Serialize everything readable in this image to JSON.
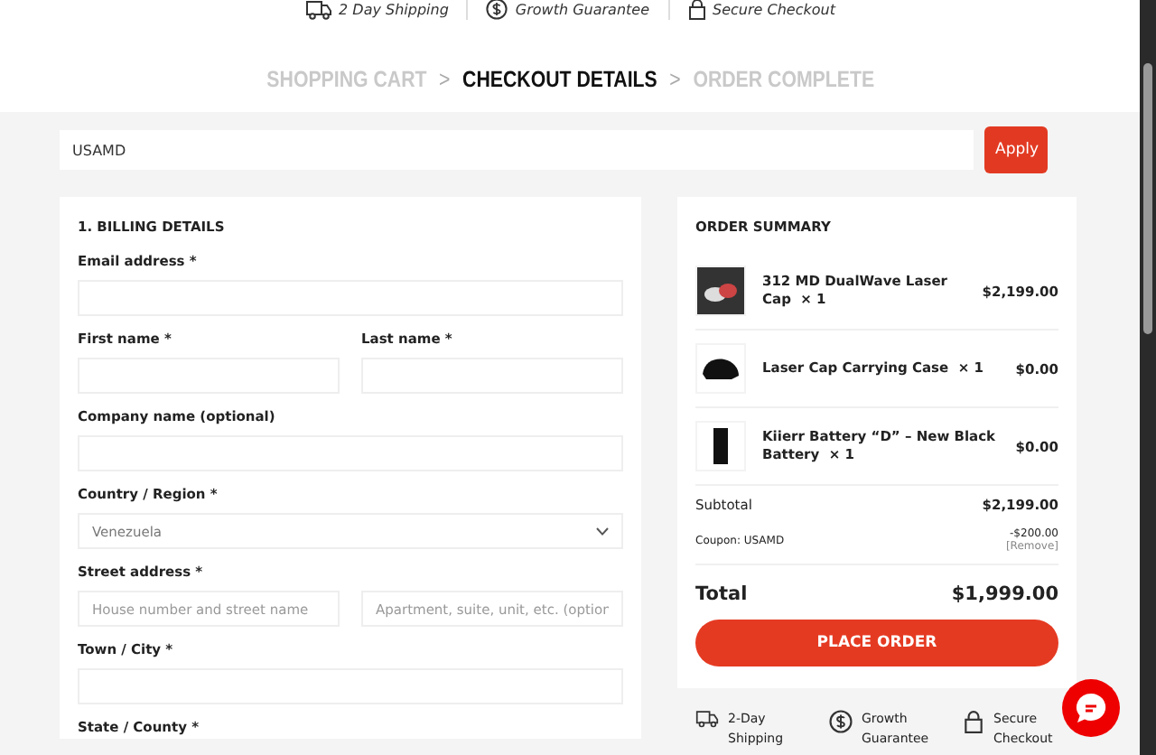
{
  "trust_badges": [
    {
      "kind": "shipping",
      "text": "2 Day Shipping"
    },
    {
      "kind": "guarantee",
      "text": "Growth Guarantee"
    },
    {
      "kind": "secure",
      "text": "Secure Checkout"
    }
  ],
  "steps": [
    {
      "label": "SHOPPING CART",
      "selected": false
    },
    {
      "label": "CHECKOUT DETAILS",
      "selected": true
    },
    {
      "label": "ORDER COMPLETE",
      "selected": false
    }
  ],
  "step_separator": ">",
  "coupon": {
    "value": "USAMD",
    "button": "Apply"
  },
  "billing": {
    "title": "1. BILLING DETAILS",
    "rows": [
      {
        "label": "Email address *",
        "fields": [
          {
            "kind": "text"
          }
        ]
      },
      {
        "fields": [
          {
            "kind": "text",
            "label": "First name *"
          },
          {
            "kind": "text",
            "label": "Last name *"
          }
        ]
      },
      {
        "label": "Company name (optional)",
        "fields": [
          {
            "kind": "text"
          }
        ]
      },
      {
        "label": "Country / Region *",
        "fields": [
          {
            "kind": "select",
            "value": "Venezuela"
          }
        ]
      },
      {
        "label": "Street address *",
        "fields": [
          {
            "kind": "text",
            "placeholder": "House number and street name"
          },
          {
            "kind": "text",
            "placeholder": "Apartment, suite, unit, etc. (option"
          }
        ]
      },
      {
        "label": "Town / City *",
        "fields": [
          {
            "kind": "text"
          }
        ]
      },
      {
        "label": "State / County *",
        "fields": []
      }
    ]
  },
  "summary": {
    "title": "ORDER SUMMARY",
    "items": [
      {
        "kind": "cap",
        "name": "312 MD DualWave Laser Cap",
        "qty": "× 1",
        "price": "$2,199.00"
      },
      {
        "kind": "case",
        "name": "Laser Cap Carrying Case",
        "qty": "× 1",
        "price": "$0.00"
      },
      {
        "kind": "battery",
        "name": "Kiierr Battery “D” – New Black Battery",
        "qty": "× 1",
        "price": "$0.00"
      }
    ],
    "subtotal_label": "Subtotal",
    "subtotal": "$2,199.00",
    "coupon_label": "Coupon: USAMD",
    "coupon_amount": "-$200.00",
    "remove": "[Remove]",
    "total_label": "Total",
    "total": "$1,999.00",
    "button": "PLACE ORDER"
  },
  "bottom_badges": [
    {
      "kind": "shipping",
      "text": "2-Day Shipping"
    },
    {
      "kind": "guarantee",
      "text": "Growth Guarantee"
    },
    {
      "kind": "secure",
      "text": "Secure Checkout"
    }
  ]
}
